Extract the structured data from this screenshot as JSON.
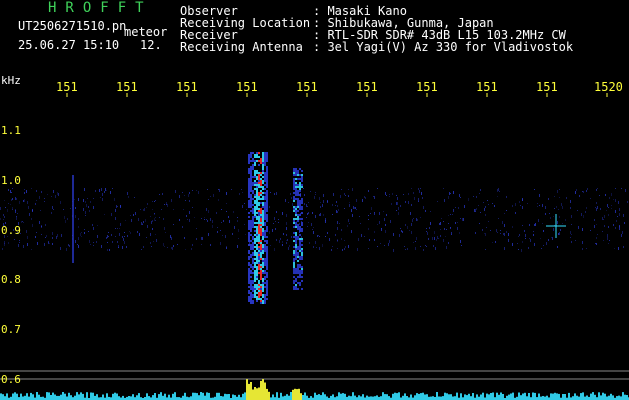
{
  "header": {
    "app_title": "HROFFT",
    "filename": "UT2506271510.pn",
    "mode": "meteor",
    "datetime": "25.06.27 15:10",
    "count": "12.",
    "info": [
      {
        "label": "Observer",
        "value": ": Masaki Kano"
      },
      {
        "label": "Receiving Location",
        "value": ": Shibukawa, Gunma, Japan"
      },
      {
        "label": "Receiver",
        "value": ": RTL-SDR SDR# 43dB L15 103.2MHz CW"
      },
      {
        "label": "Receiving Antenna",
        "value": ": 3el Yagi(V) Az 330 for Vladivostok"
      }
    ]
  },
  "axis": {
    "y_unit": "kHz",
    "time_ticks": [
      "151",
      "151",
      "151",
      "151",
      "151",
      "151",
      "151",
      "151",
      "151",
      "1520"
    ],
    "freq_ticks": [
      "1.1",
      "1.0",
      "0.9",
      "0.8",
      "0.7",
      "0.6"
    ]
  },
  "colors": {
    "background": "#000000",
    "title_green": "#3fd25a",
    "tick_yellow": "#ffff3a",
    "noise_blue": "#2b3bd6",
    "signal_cyan": "#35e0ff",
    "signal_red": "#ff2a2a"
  }
}
